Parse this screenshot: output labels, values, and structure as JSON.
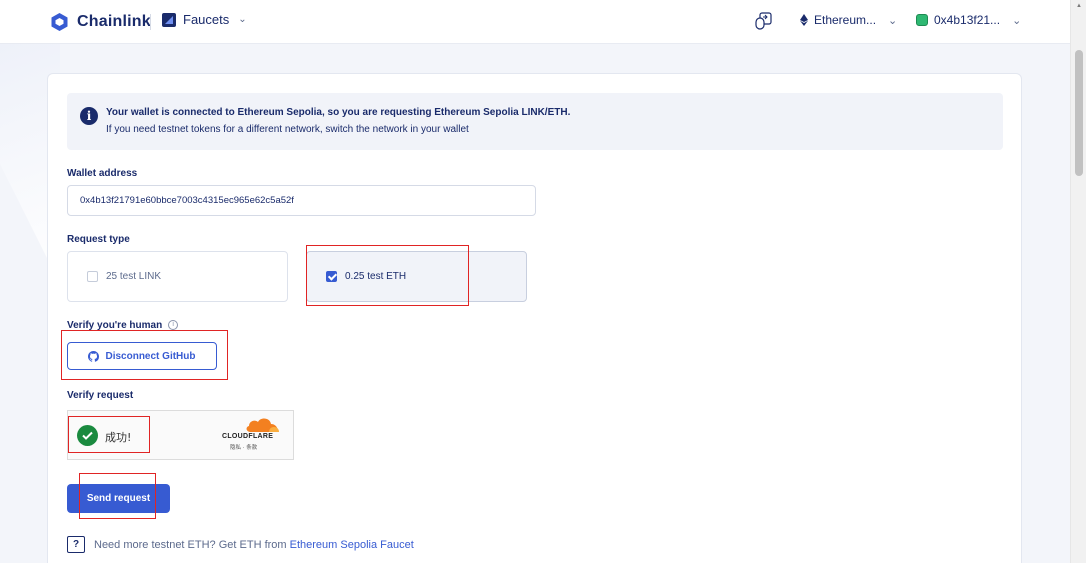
{
  "header": {
    "brand": "Chainlink",
    "section": "Faucets",
    "network": "Ethereum...",
    "account": "0x4b13f21..."
  },
  "info": {
    "line1": "Your wallet is connected to Ethereum Sepolia, so you are requesting Ethereum Sepolia LINK/ETH.",
    "line2": "If you need testnet tokens for a different network, switch the network in your wallet"
  },
  "wallet": {
    "label": "Wallet address",
    "value": "0x4b13f21791e60bbce7003c4315ec965e62c5a52f"
  },
  "request_type": {
    "label": "Request type",
    "options": [
      {
        "label": "25 test LINK",
        "checked": false
      },
      {
        "label": "0.25 test ETH",
        "checked": true
      }
    ]
  },
  "verify_human": {
    "label": "Verify you're human",
    "button": "Disconnect GitHub"
  },
  "verify_request": {
    "label": "Verify request",
    "status": "成功!",
    "provider": "CLOUDFLARE",
    "links": "隐私 · 条款"
  },
  "send_button": "Send request",
  "footer": {
    "text": "Need more testnet ETH? Get ETH from",
    "link": "Ethereum Sepolia Faucet"
  },
  "colors": {
    "primary": "#375bd2",
    "navy": "#1a2b6b",
    "success": "#1a8a3f",
    "annotation": "#e02424",
    "cloudflare": "#f38020"
  }
}
